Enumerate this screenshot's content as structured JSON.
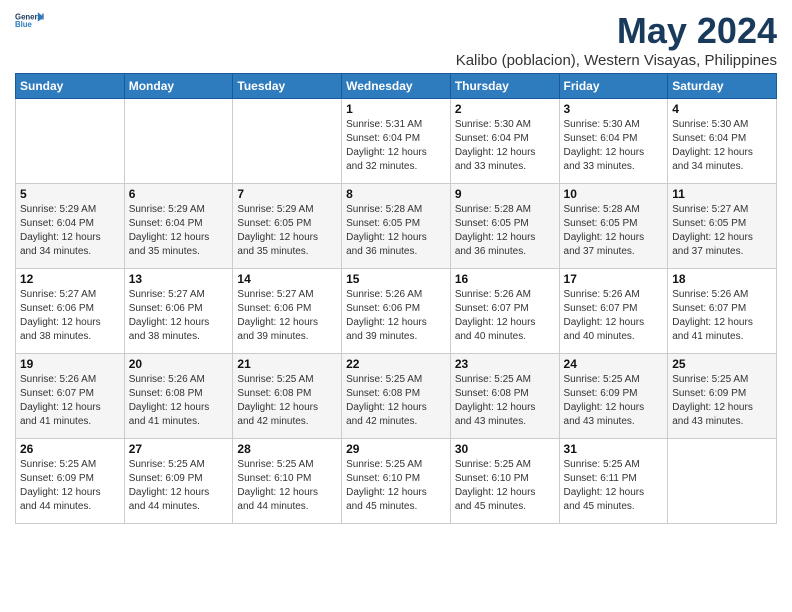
{
  "logo": {
    "line1": "General",
    "line2": "Blue"
  },
  "title": "May 2024",
  "subtitle": "Kalibo (poblacion), Western Visayas, Philippines",
  "days_of_week": [
    "Sunday",
    "Monday",
    "Tuesday",
    "Wednesday",
    "Thursday",
    "Friday",
    "Saturday"
  ],
  "weeks": [
    [
      {
        "day": "",
        "info": ""
      },
      {
        "day": "",
        "info": ""
      },
      {
        "day": "",
        "info": ""
      },
      {
        "day": "1",
        "info": "Sunrise: 5:31 AM\nSunset: 6:04 PM\nDaylight: 12 hours\nand 32 minutes."
      },
      {
        "day": "2",
        "info": "Sunrise: 5:30 AM\nSunset: 6:04 PM\nDaylight: 12 hours\nand 33 minutes."
      },
      {
        "day": "3",
        "info": "Sunrise: 5:30 AM\nSunset: 6:04 PM\nDaylight: 12 hours\nand 33 minutes."
      },
      {
        "day": "4",
        "info": "Sunrise: 5:30 AM\nSunset: 6:04 PM\nDaylight: 12 hours\nand 34 minutes."
      }
    ],
    [
      {
        "day": "5",
        "info": "Sunrise: 5:29 AM\nSunset: 6:04 PM\nDaylight: 12 hours\nand 34 minutes."
      },
      {
        "day": "6",
        "info": "Sunrise: 5:29 AM\nSunset: 6:04 PM\nDaylight: 12 hours\nand 35 minutes."
      },
      {
        "day": "7",
        "info": "Sunrise: 5:29 AM\nSunset: 6:05 PM\nDaylight: 12 hours\nand 35 minutes."
      },
      {
        "day": "8",
        "info": "Sunrise: 5:28 AM\nSunset: 6:05 PM\nDaylight: 12 hours\nand 36 minutes."
      },
      {
        "day": "9",
        "info": "Sunrise: 5:28 AM\nSunset: 6:05 PM\nDaylight: 12 hours\nand 36 minutes."
      },
      {
        "day": "10",
        "info": "Sunrise: 5:28 AM\nSunset: 6:05 PM\nDaylight: 12 hours\nand 37 minutes."
      },
      {
        "day": "11",
        "info": "Sunrise: 5:27 AM\nSunset: 6:05 PM\nDaylight: 12 hours\nand 37 minutes."
      }
    ],
    [
      {
        "day": "12",
        "info": "Sunrise: 5:27 AM\nSunset: 6:06 PM\nDaylight: 12 hours\nand 38 minutes."
      },
      {
        "day": "13",
        "info": "Sunrise: 5:27 AM\nSunset: 6:06 PM\nDaylight: 12 hours\nand 38 minutes."
      },
      {
        "day": "14",
        "info": "Sunrise: 5:27 AM\nSunset: 6:06 PM\nDaylight: 12 hours\nand 39 minutes."
      },
      {
        "day": "15",
        "info": "Sunrise: 5:26 AM\nSunset: 6:06 PM\nDaylight: 12 hours\nand 39 minutes."
      },
      {
        "day": "16",
        "info": "Sunrise: 5:26 AM\nSunset: 6:07 PM\nDaylight: 12 hours\nand 40 minutes."
      },
      {
        "day": "17",
        "info": "Sunrise: 5:26 AM\nSunset: 6:07 PM\nDaylight: 12 hours\nand 40 minutes."
      },
      {
        "day": "18",
        "info": "Sunrise: 5:26 AM\nSunset: 6:07 PM\nDaylight: 12 hours\nand 41 minutes."
      }
    ],
    [
      {
        "day": "19",
        "info": "Sunrise: 5:26 AM\nSunset: 6:07 PM\nDaylight: 12 hours\nand 41 minutes."
      },
      {
        "day": "20",
        "info": "Sunrise: 5:26 AM\nSunset: 6:08 PM\nDaylight: 12 hours\nand 41 minutes."
      },
      {
        "day": "21",
        "info": "Sunrise: 5:25 AM\nSunset: 6:08 PM\nDaylight: 12 hours\nand 42 minutes."
      },
      {
        "day": "22",
        "info": "Sunrise: 5:25 AM\nSunset: 6:08 PM\nDaylight: 12 hours\nand 42 minutes."
      },
      {
        "day": "23",
        "info": "Sunrise: 5:25 AM\nSunset: 6:08 PM\nDaylight: 12 hours\nand 43 minutes."
      },
      {
        "day": "24",
        "info": "Sunrise: 5:25 AM\nSunset: 6:09 PM\nDaylight: 12 hours\nand 43 minutes."
      },
      {
        "day": "25",
        "info": "Sunrise: 5:25 AM\nSunset: 6:09 PM\nDaylight: 12 hours\nand 43 minutes."
      }
    ],
    [
      {
        "day": "26",
        "info": "Sunrise: 5:25 AM\nSunset: 6:09 PM\nDaylight: 12 hours\nand 44 minutes."
      },
      {
        "day": "27",
        "info": "Sunrise: 5:25 AM\nSunset: 6:09 PM\nDaylight: 12 hours\nand 44 minutes."
      },
      {
        "day": "28",
        "info": "Sunrise: 5:25 AM\nSunset: 6:10 PM\nDaylight: 12 hours\nand 44 minutes."
      },
      {
        "day": "29",
        "info": "Sunrise: 5:25 AM\nSunset: 6:10 PM\nDaylight: 12 hours\nand 45 minutes."
      },
      {
        "day": "30",
        "info": "Sunrise: 5:25 AM\nSunset: 6:10 PM\nDaylight: 12 hours\nand 45 minutes."
      },
      {
        "day": "31",
        "info": "Sunrise: 5:25 AM\nSunset: 6:11 PM\nDaylight: 12 hours\nand 45 minutes."
      },
      {
        "day": "",
        "info": ""
      }
    ]
  ]
}
